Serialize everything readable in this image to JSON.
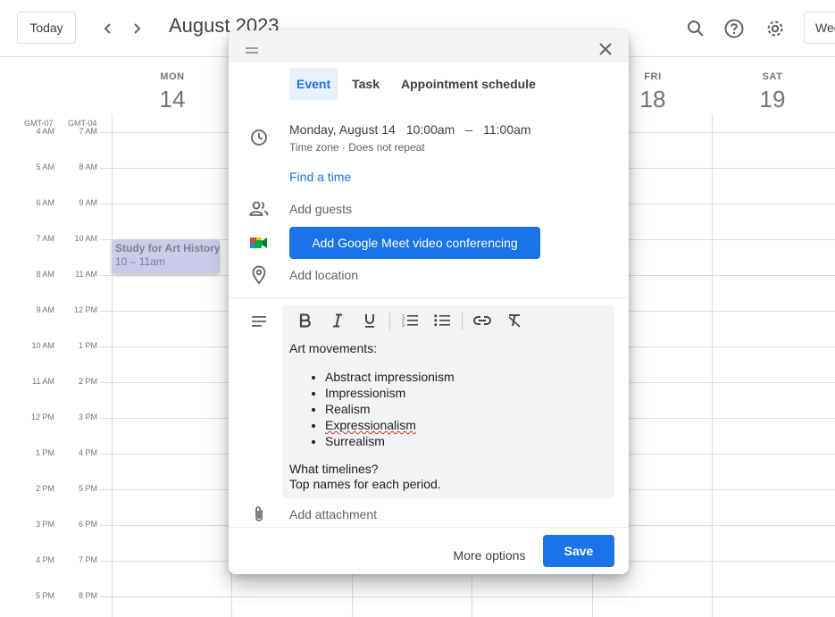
{
  "topbar": {
    "today_label": "Today",
    "month_title": "August 2023",
    "view_label": "Week"
  },
  "day_headers": [
    {
      "name": "MON",
      "num": "14"
    },
    {
      "name": "FRI",
      "num": "18"
    },
    {
      "name": "SAT",
      "num": "19"
    }
  ],
  "timezones": {
    "primary": "GMT-07",
    "secondary": "GMT-04"
  },
  "time_rows": [
    {
      "primary": "4 AM",
      "secondary": "7 AM"
    },
    {
      "primary": "5 AM",
      "secondary": "8 AM"
    },
    {
      "primary": "6 AM",
      "secondary": "9 AM"
    },
    {
      "primary": "7 AM",
      "secondary": "10 AM"
    },
    {
      "primary": "8 AM",
      "secondary": "11 AM"
    },
    {
      "primary": "9 AM",
      "secondary": "12 PM"
    },
    {
      "primary": "10 AM",
      "secondary": "1 PM"
    },
    {
      "primary": "11 AM",
      "secondary": "2 PM"
    },
    {
      "primary": "12 PM",
      "secondary": "3 PM"
    },
    {
      "primary": "1 PM",
      "secondary": "4 PM"
    },
    {
      "primary": "2 PM",
      "secondary": "5 PM"
    },
    {
      "primary": "3 PM",
      "secondary": "6 PM"
    },
    {
      "primary": "4 PM",
      "secondary": "7 PM"
    },
    {
      "primary": "5 PM",
      "secondary": "8 PM"
    }
  ],
  "calendar_event": {
    "title": "Study for Art History l",
    "time": "10 – 11am",
    "color": "#c9cbe8"
  },
  "dialog": {
    "tabs": [
      {
        "label": "Event",
        "active": true
      },
      {
        "label": "Task",
        "active": false
      },
      {
        "label": "Appointment schedule",
        "active": false
      }
    ],
    "date": "Monday, August 14",
    "start_time": "10:00am",
    "dash": "–",
    "end_time": "11:00am",
    "timezone_repeat": "Time zone · Does not repeat",
    "find_time": "Find a time",
    "add_guests": "Add guests",
    "meet_button": "Add Google Meet video conferencing",
    "add_location": "Add location",
    "description": {
      "heading": "Art movements:",
      "items": [
        "Abstract impressionism",
        "Impressionism",
        "Realism",
        "Expressionalism",
        "Surrealism"
      ],
      "line1": "What timelines?",
      "line2": "Top names for each period."
    },
    "add_attachment": "Add attachment",
    "more_options": "More options",
    "save": "Save",
    "accent_color": "#1a73e8"
  }
}
